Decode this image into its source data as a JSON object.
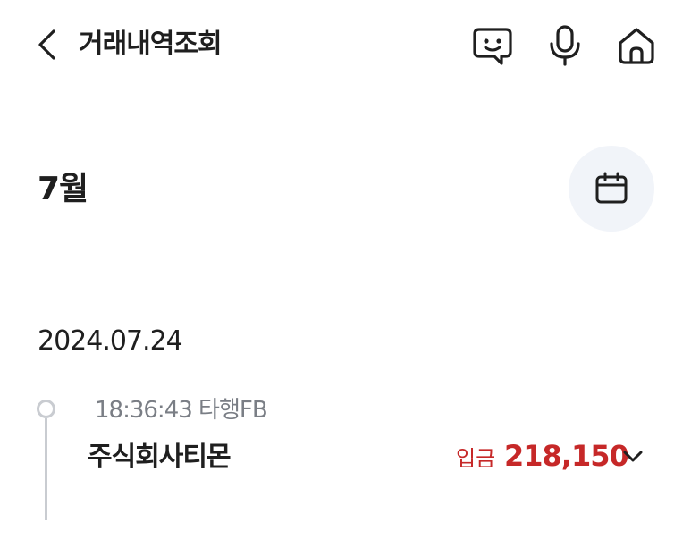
{
  "header": {
    "title": "거래내역조회",
    "icons": [
      "back-chevron-icon",
      "chatbot-icon",
      "microphone-icon",
      "home-icon"
    ]
  },
  "month_section": {
    "label": "7월",
    "calendar_icon": "calendar-icon"
  },
  "groups": [
    {
      "date": "2024.07.24",
      "transactions": [
        {
          "time": "18:36:43",
          "bank": "타행FB",
          "name": "주식회사티몬",
          "type": "입금",
          "amount": "218,150"
        }
      ]
    }
  ],
  "colors": {
    "deposit": "#c62828",
    "muted_text": "#7a7e85",
    "timeline": "#c9ccd1",
    "calendar_bg": "#f1f4f9"
  }
}
